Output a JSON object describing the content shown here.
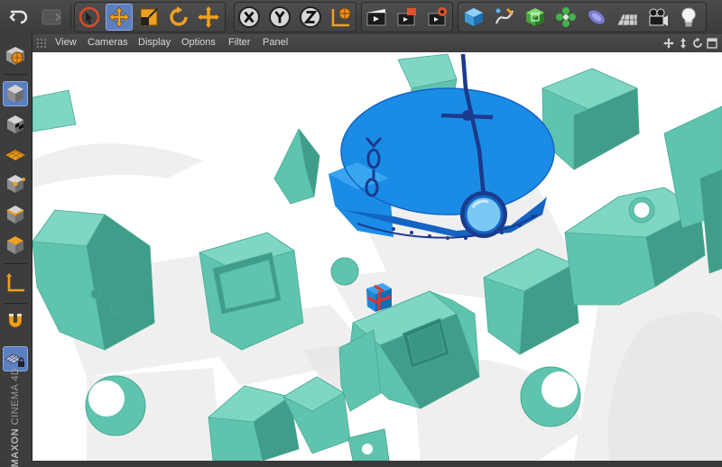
{
  "viewport": {
    "menu": [
      "View",
      "Cameras",
      "Display",
      "Options",
      "Filter",
      "Panel"
    ]
  },
  "branding": {
    "line1": "MAXON",
    "line2": "CINEMA 4D"
  },
  "colors": {
    "building": "#5fc4ad",
    "building_dark": "#3f9d89",
    "building_light": "#7fd6c2",
    "submarine": "#1a8ce6",
    "submarine_dark": "#1c3a8c",
    "active_tool": "#5b7fbf",
    "shadow": "#ececec"
  },
  "toolbar": {
    "icons": [
      "undo-icon",
      "redo-icon",
      "live-selection-icon",
      "move-icon",
      "scale-icon",
      "rotate-icon",
      "transform-icon",
      "lock-x-icon",
      "lock-y-icon",
      "lock-z-icon",
      "coordinate-system-icon",
      "render-view-icon",
      "render-picture-viewer-icon",
      "render-settings-icon",
      "cube-primitive-icon",
      "spline-pen-icon",
      "subdivision-icon",
      "array-icon",
      "deformer-icon",
      "floor-icon",
      "camera-icon",
      "light-icon"
    ]
  },
  "palette": {
    "icons": [
      "make-editable-icon",
      "model-mode-icon",
      "texture-mode-icon",
      "workplane-mode-icon",
      "points-mode-icon",
      "edges-mode-icon",
      "polygons-mode-icon",
      "axis-mode-icon",
      "snap-magnet-icon",
      "locked-workplane-icon"
    ]
  }
}
